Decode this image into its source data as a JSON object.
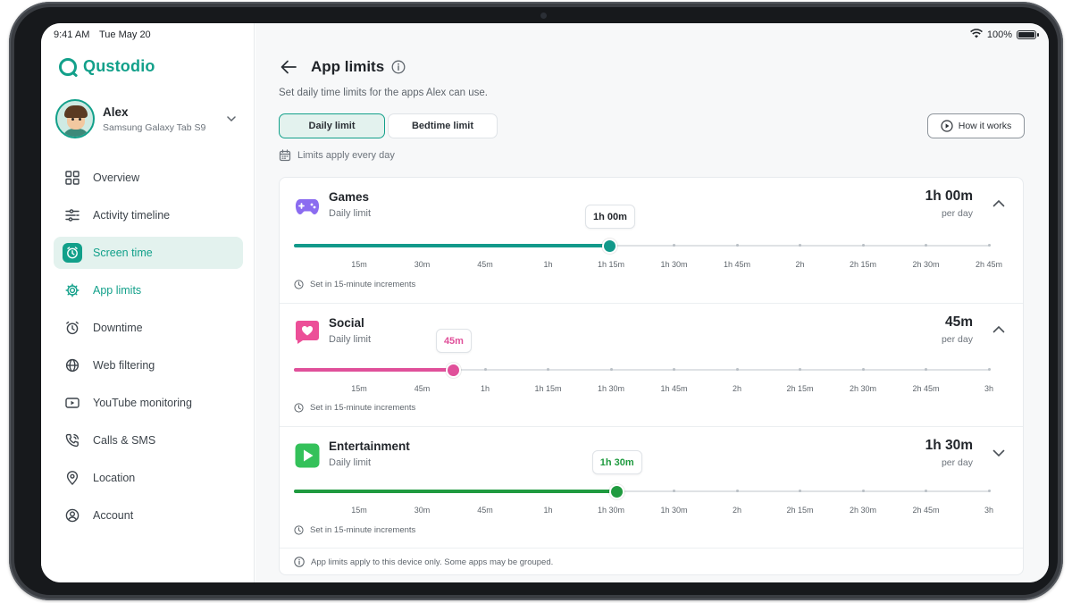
{
  "status_bar": {
    "time": "9:41 AM",
    "date": "Tue May 20",
    "battery": "100%",
    "battery_level": 1.0
  },
  "brand": {
    "name": "Qustodio",
    "color": "#12a08a"
  },
  "profile": {
    "name": "Alex",
    "device": "Samsung Galaxy Tab S9"
  },
  "nav": {
    "items": [
      {
        "label": "Overview",
        "icon": "grid-icon"
      },
      {
        "label": "Activity timeline",
        "icon": "timeline-icon"
      },
      {
        "label": "Screen time",
        "icon": "clock-icon",
        "active": true
      },
      {
        "label": "App limits",
        "icon": "app-limits-icon",
        "sub_active": true
      },
      {
        "label": "Downtime",
        "icon": "alarm-icon"
      },
      {
        "label": "Web filtering",
        "icon": "globe-icon"
      },
      {
        "label": "YouTube monitoring",
        "icon": "video-icon"
      },
      {
        "label": "Calls & SMS",
        "icon": "phone-icon"
      },
      {
        "label": "Location",
        "icon": "location-pin-icon"
      },
      {
        "label": "Account",
        "icon": "account-icon"
      }
    ]
  },
  "page": {
    "title": "App limits",
    "subtitle": "Set daily time limits for the apps Alex can use.",
    "tabs": [
      "Daily limit",
      "Bedtime limit"
    ],
    "active_tab": "Daily limit",
    "how_it_works": "How it works",
    "applies": "Limits apply every day",
    "footer_note": "App limits apply to this device only. Some apps may be grouped."
  },
  "apps": [
    {
      "name": "Games",
      "sub": "Daily limit",
      "value": "1h 00m",
      "per_day": "per day",
      "bubble": "1h 00m",
      "color": "#12998a",
      "icon": "gamepad-icon",
      "icon_bg": "#8b6cf0",
      "expanded": true,
      "slider_fraction": 0.455,
      "ticks": [
        "15m",
        "30m",
        "45m",
        "1h",
        "1h 15m",
        "1h 30m",
        "1h 45m",
        "2h",
        "2h 15m",
        "2h 30m",
        "2h 45m"
      ],
      "note": "Set in 15-minute increments"
    },
    {
      "name": "Social",
      "sub": "Daily limit",
      "value": "45m",
      "per_day": "per day",
      "bubble": "45m",
      "color": "#e0509a",
      "icon": "heart-chat-icon",
      "icon_bg": "#ec4f98",
      "expanded": true,
      "slider_fraction": 0.23,
      "ticks": [
        "15m",
        "45m",
        "1h",
        "1h 15m",
        "1h 30m",
        "1h 45m",
        "2h",
        "2h 15m",
        "2h 30m",
        "2h 45m",
        "3h"
      ],
      "note": "Set in 15-minute increments"
    },
    {
      "name": "Entertainment",
      "sub": "Daily limit",
      "value": "1h 30m",
      "per_day": "per day",
      "bubble": "1h 30m",
      "color": "#1f9a3f",
      "icon": "play-icon",
      "icon_bg": "#34c15a",
      "expanded": false,
      "slider_fraction": 0.465,
      "ticks": [
        "15m",
        "30m",
        "45m",
        "1h",
        "1h 30m",
        "1h 30m",
        "2h",
        "2h 15m",
        "2h 30m",
        "2h 45m",
        "3h"
      ],
      "note": "Set in 15-minute increments"
    }
  ]
}
